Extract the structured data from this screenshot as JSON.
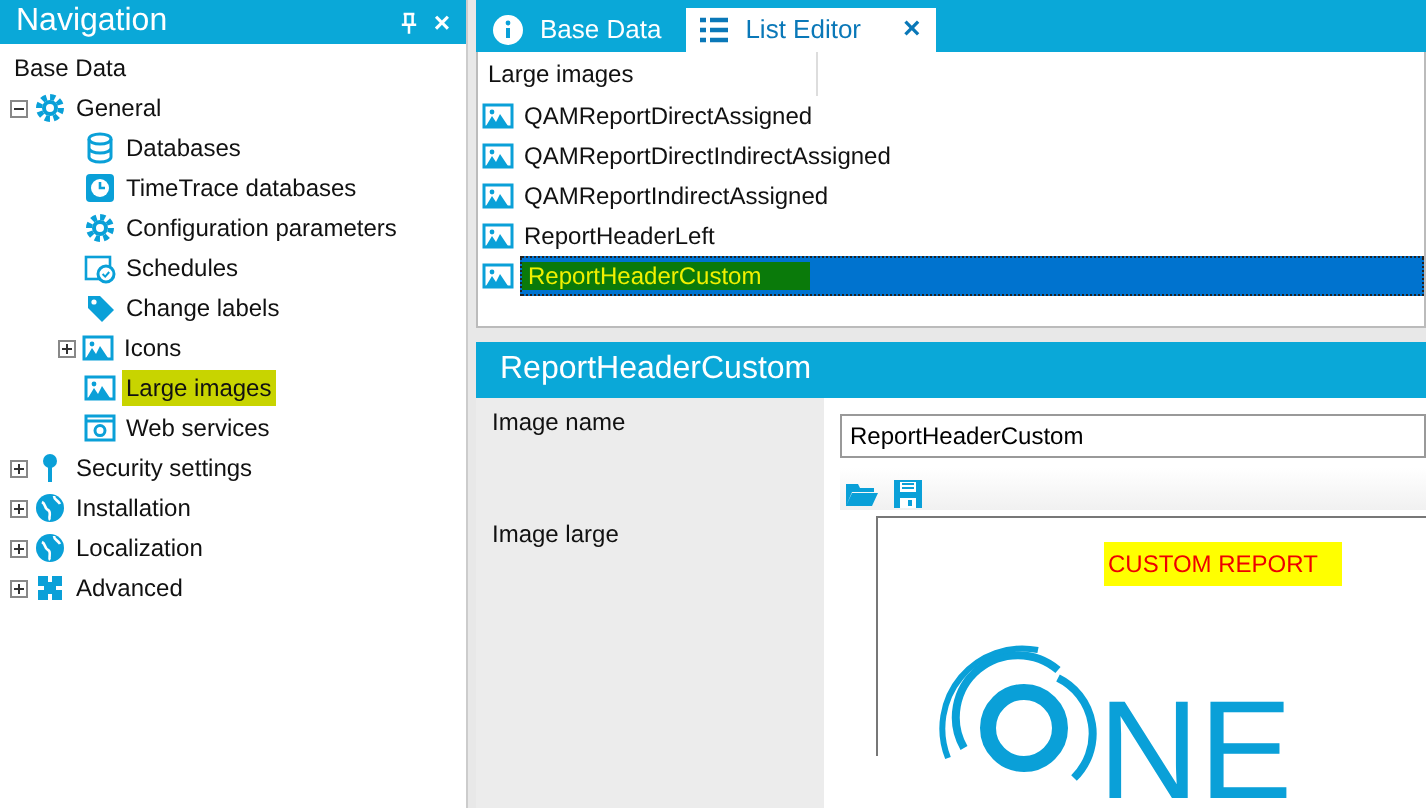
{
  "navigation": {
    "title": "Navigation",
    "close": "×",
    "root": "Base Data",
    "tree": [
      {
        "label": "General",
        "kind": "gear",
        "expanded": true,
        "selected": false,
        "children": [
          {
            "label": "Databases",
            "kind": "database",
            "selected": false
          },
          {
            "label": "TimeTrace databases",
            "kind": "clock",
            "selected": false
          },
          {
            "label": "Configuration parameters",
            "kind": "gear",
            "selected": false
          },
          {
            "label": "Schedules",
            "kind": "calendar",
            "selected": false
          },
          {
            "label": "Change labels",
            "kind": "tag",
            "selected": false
          },
          {
            "label": "Icons",
            "kind": "image",
            "expanded": false,
            "selected": false
          },
          {
            "label": "Large images",
            "kind": "image",
            "selected": true
          },
          {
            "label": "Web services",
            "kind": "window",
            "selected": false
          }
        ]
      },
      {
        "label": "Security settings",
        "kind": "key",
        "expanded": false,
        "selected": false
      },
      {
        "label": "Installation",
        "kind": "globe",
        "expanded": false,
        "selected": false
      },
      {
        "label": "Localization",
        "kind": "globe",
        "expanded": false,
        "selected": false
      },
      {
        "label": "Advanced",
        "kind": "puzzle",
        "expanded": false,
        "selected": false
      }
    ]
  },
  "tabs": [
    {
      "label": "Base Data",
      "kind": "info",
      "selected": false
    },
    {
      "label": "List Editor",
      "kind": "list",
      "selected": true,
      "close": "×"
    }
  ],
  "list": {
    "column": "Large images",
    "rows": [
      {
        "label": "QAMReportDirectAssigned",
        "selected": false
      },
      {
        "label": "QAMReportDirectIndirectAssigned",
        "selected": false
      },
      {
        "label": "QAMReportIndirectAssigned",
        "selected": false
      },
      {
        "label": "ReportHeaderLeft",
        "selected": false
      },
      {
        "label": "ReportHeaderCustom",
        "selected": true
      }
    ]
  },
  "detail": {
    "title": "ReportHeaderCustom",
    "fields": [
      {
        "label": "Image  name",
        "kind": "text",
        "value": "ReportHeaderCustom"
      },
      {
        "label": "Image large",
        "kind": "image",
        "caption": "CUSTOM REPORT",
        "logo_text": "NE"
      }
    ]
  }
}
